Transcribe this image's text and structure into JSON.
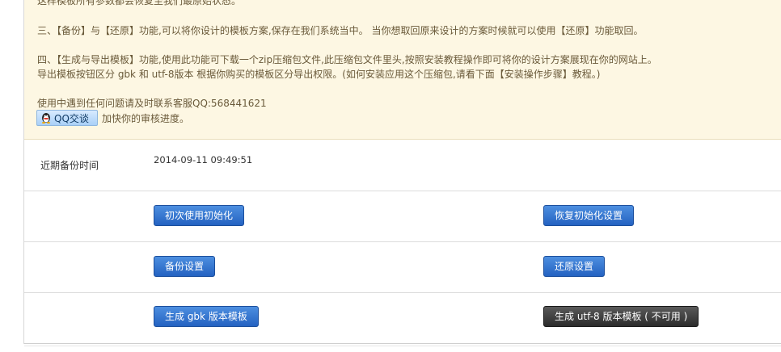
{
  "notice": {
    "line_top_partial": "这样模板所有参数都会恢复至我们最原始状态。",
    "line_restore": "三、【备份】与【还原】功能,可以将你设计的模板方案,保存在我们系统当中。 当你想取回原来设计的方案时候就可以使用【还原】功能取回。",
    "line_generate": "四、【生成与导出模板】功能,使用此功能可下载一个zip压缩包文件,此压缩包文件里头,按照安装教程操作即可将你的设计方案展现在你的网站上。",
    "line_export": "导出模板按钮区分 gbk 和 utf-8版本 根据你购买的模板区分导出权限。(如何安装应用这个压缩包,请看下面【安装操作步骤】教程。)",
    "line_contact": "使用中遇到任何问题请及时联系客服QQ:568441621",
    "qq_button_label": "QQ交谈",
    "qq_after_text": "加快你的审核进度。"
  },
  "backup": {
    "label": "近期备份时间",
    "time": "2014-09-11 09:49:51"
  },
  "actions": {
    "init_first": "初次使用初始化",
    "restore_init": "恢复初始化设置",
    "backup_settings": "备份设置",
    "restore_settings": "还原设置",
    "gen_gbk": "生成 gbk 版本模板",
    "gen_utf8": "生成 utf-8 版本模板 ( 不可用 )"
  },
  "colors": {
    "notice_bg": "#fdf7e3",
    "primary_button": "#2462c1",
    "disabled_button": "#2b2b2b"
  }
}
